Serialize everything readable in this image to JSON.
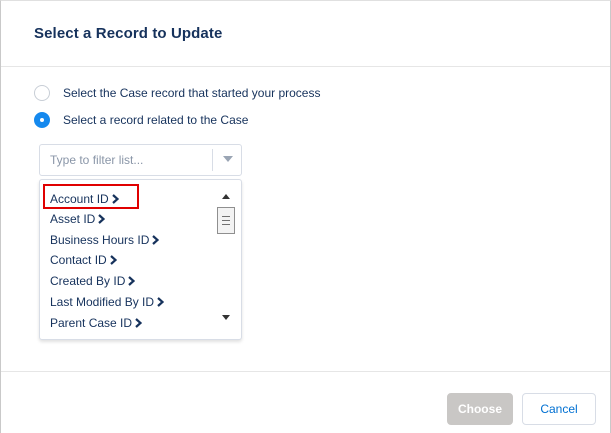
{
  "dialog": {
    "title": "Select a Record to Update"
  },
  "options": [
    {
      "label": "Select the Case record that started your process",
      "checked": false
    },
    {
      "label": "Select a record related to the Case",
      "checked": true
    }
  ],
  "filter": {
    "placeholder": "Type to filter list..."
  },
  "list": {
    "items": [
      "Account ID",
      "Asset ID",
      "Business Hours ID",
      "Contact ID",
      "Created By ID",
      "Last Modified By ID",
      "Parent Case ID"
    ],
    "highlighted_item": "Account ID"
  },
  "footer": {
    "choose_label": "Choose",
    "cancel_label": "Cancel"
  },
  "colors": {
    "radio_checked": "#1589ee",
    "title_text": "#16325c",
    "highlight_border": "#e00000",
    "choose_disabled": "#c9c7c5",
    "cancel_text": "#0070d2"
  }
}
